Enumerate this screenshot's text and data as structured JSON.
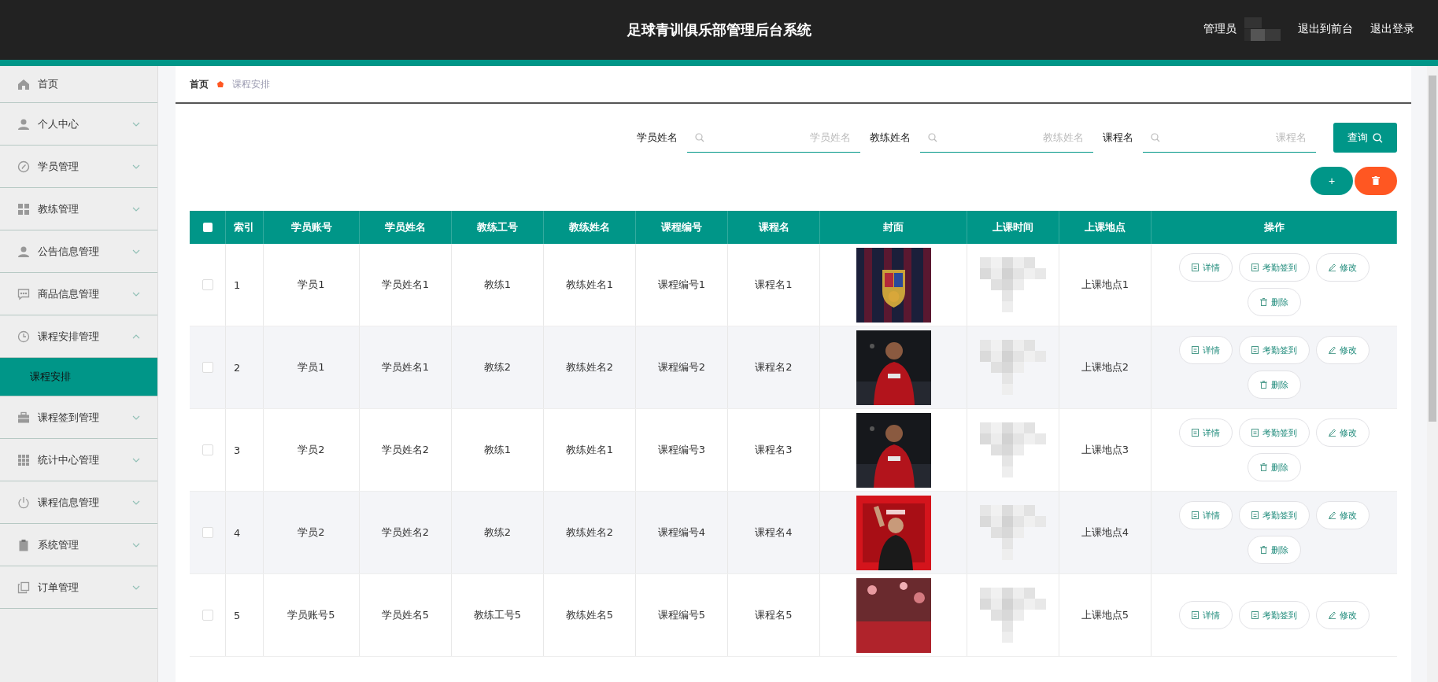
{
  "header": {
    "title": "足球青训俱乐部管理后台系统",
    "user_label": "管理员",
    "links": [
      "退出到前台",
      "退出登录"
    ]
  },
  "sidebar": {
    "items": [
      {
        "label": "首页"
      },
      {
        "label": "个人中心",
        "expanded": false
      },
      {
        "label": "学员管理",
        "expanded": false
      },
      {
        "label": "教练管理",
        "expanded": false
      },
      {
        "label": "公告信息管理",
        "expanded": false
      },
      {
        "label": "商品信息管理",
        "expanded": false
      },
      {
        "label": "课程安排管理",
        "expanded": true,
        "children": [
          {
            "label": "课程安排",
            "selected": true
          }
        ]
      },
      {
        "label": "课程签到管理",
        "expanded": false
      },
      {
        "label": "统计中心管理",
        "expanded": false
      },
      {
        "label": "课程信息管理",
        "expanded": false
      },
      {
        "label": "系统管理",
        "expanded": false
      },
      {
        "label": "订单管理",
        "expanded": false
      }
    ]
  },
  "breadcrumb": [
    "首页",
    "课程安排"
  ],
  "search": {
    "fields": [
      {
        "label": "学员姓名",
        "placeholder": "学员姓名"
      },
      {
        "label": "教练姓名",
        "placeholder": "教练姓名"
      },
      {
        "label": "课程名",
        "placeholder": "课程名"
      }
    ],
    "button": "查询"
  },
  "toolbar": {
    "add": "+"
  },
  "table": {
    "select_all": {
      "checked": false
    },
    "columns": [
      "索引",
      "学员账号",
      "学员姓名",
      "教练工号",
      "教练姓名",
      "课程编号",
      "课程名",
      "封面",
      "上课时间",
      "上课地点",
      "操作"
    ],
    "rows": [
      {
        "selected": false,
        "cells": [
          "1",
          "学员1",
          "学员姓名1",
          "教练1",
          "教练姓名1",
          "课程编号1",
          "课程名1"
        ],
        "cover": {
          "kind": "picture"
        },
        "place": "上课地点1",
        "actions": [
          "详情",
          "考勤签到",
          "修改",
          "删除"
        ]
      },
      {
        "selected": false,
        "cells": [
          "2",
          "学员1",
          "学员姓名1",
          "教练2",
          "教练姓名2",
          "课程编号2",
          "课程名2"
        ],
        "cover": {
          "kind": "picture"
        },
        "place": "上课地点2",
        "actions": [
          "详情",
          "考勤签到",
          "修改",
          "删除"
        ]
      },
      {
        "selected": false,
        "cells": [
          "3",
          "学员2",
          "学员姓名2",
          "教练1",
          "教练姓名1",
          "课程编号3",
          "课程名3"
        ],
        "cover": {
          "kind": "picture"
        },
        "place": "上课地点3",
        "actions": [
          "详情",
          "考勤签到",
          "修改",
          "删除"
        ]
      },
      {
        "selected": false,
        "cells": [
          "4",
          "学员2",
          "学员姓名2",
          "教练2",
          "教练姓名2",
          "课程编号4",
          "课程名4"
        ],
        "cover": {
          "kind": "picture"
        },
        "place": "上课地点4",
        "actions": [
          "详情",
          "考勤签到",
          "修改",
          "删除"
        ]
      },
      {
        "selected": false,
        "cells": [
          "5",
          "学员账号5",
          "学员姓名5",
          "教练工号5",
          "教练姓名5",
          "课程编号5",
          "课程名5"
        ],
        "cover": {
          "kind": "picture"
        },
        "place": "上课地点5",
        "actions": [
          "详情",
          "考勤签到",
          "修改"
        ]
      }
    ]
  }
}
